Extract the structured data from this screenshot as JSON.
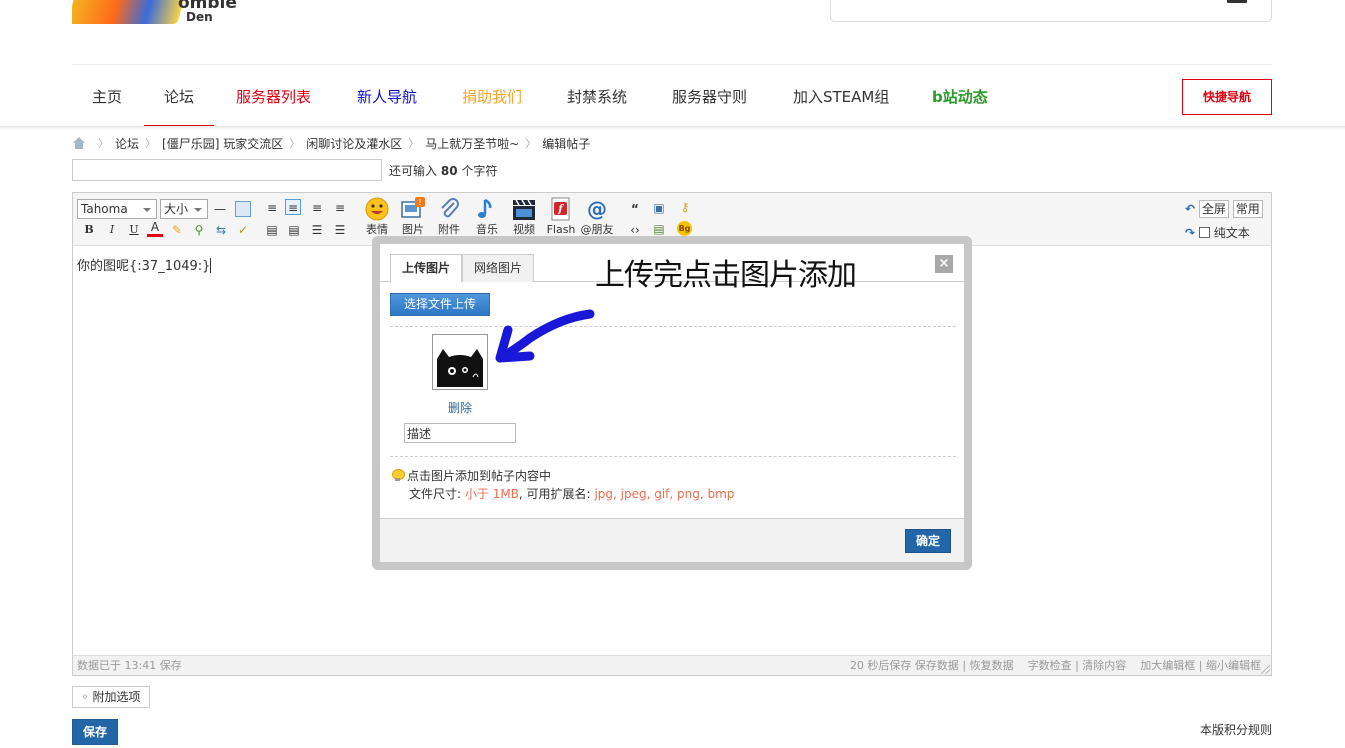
{
  "header": {
    "logo_line1": "ombie",
    "logo_line2": "Den"
  },
  "nav": {
    "items": [
      {
        "label": "主页",
        "color": "#333333"
      },
      {
        "label": "论坛",
        "color": "#333333"
      },
      {
        "label": "服务器列表",
        "color": "#e40012"
      },
      {
        "label": "新人导航",
        "color": "#1010c8"
      },
      {
        "label": "捐助我们",
        "color": "#f5a623"
      },
      {
        "label": "封禁系统",
        "color": "#333333"
      },
      {
        "label": "服务器守则",
        "color": "#333333"
      },
      {
        "label": "加入STEAM组",
        "color": "#333333"
      },
      {
        "label": "b站动态",
        "color": "#2b9a2b"
      }
    ],
    "active": "论坛",
    "quick_nav": "快捷导航"
  },
  "breadcrumb": [
    "论坛",
    "[僵尸乐园] 玩家交流区",
    "闲聊讨论及灌水区",
    "马上就万圣节啦~",
    "编辑帖子"
  ],
  "title_field": {
    "value": "",
    "remain_prefix": "还可输入",
    "remain_count": "80",
    "remain_suffix": "个字符"
  },
  "toolbar": {
    "font": "Tahoma",
    "size": "大小",
    "format_buttons": [
      "B",
      "I",
      "U"
    ],
    "media": [
      {
        "label": "表情",
        "icon": "smiley-icon"
      },
      {
        "label": "图片",
        "icon": "image-icon"
      },
      {
        "label": "附件",
        "icon": "paperclip-icon"
      },
      {
        "label": "音乐",
        "icon": "music-icon"
      },
      {
        "label": "视频",
        "icon": "video-icon"
      },
      {
        "label": "Flash",
        "icon": "flash-icon"
      },
      {
        "label": "@朋友",
        "icon": "at-icon"
      }
    ],
    "fullscreen": "全屏",
    "common": "常用",
    "plain_text": "纯文本"
  },
  "editor": {
    "content": "你的图呢{:37_1049:}"
  },
  "statusbar": {
    "left": "数据已于 13:41 保存",
    "right": "20 秒后保存 保存数据 | 恢复数据    字数检查 | 清除内容    加大编辑框 | 缩小编辑框"
  },
  "extra_options": "◦ 附加选项",
  "save_button": "保存",
  "rules_link": "本版积分规则",
  "dialog": {
    "tabs": [
      "上传图片",
      "网络图片"
    ],
    "close": "×",
    "upload_button": "选择文件上传",
    "delete_link": "删除",
    "description_value": "描述",
    "tip_line1": "点击图片添加到帖子内容中",
    "tip_size_label": "文件尺寸:",
    "tip_size_value": "小于 1MB",
    "tip_ext_label": ", 可用扩展名:",
    "tip_ext_value": "jpg, jpeg, gif, png, bmp",
    "ok_button": "确定"
  },
  "annotation": {
    "text": "上传完点击图片添加"
  }
}
